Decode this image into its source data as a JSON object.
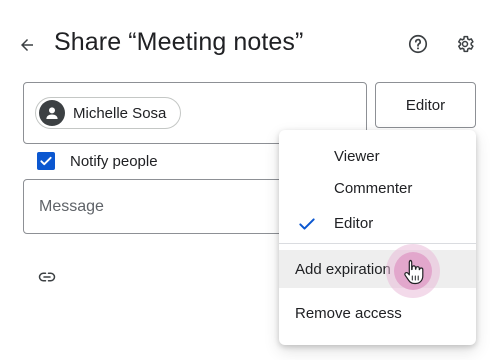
{
  "header": {
    "title": "Share “Meeting notes”",
    "back_icon": "arrow-back-icon",
    "help_icon": "help-icon",
    "settings_icon": "gear-icon"
  },
  "recipient": {
    "name": "Michelle Sosa",
    "avatar_icon": "person-icon"
  },
  "role_button": {
    "label": "Editor"
  },
  "notify": {
    "label": "Notify people",
    "checked": true
  },
  "message": {
    "placeholder": "Message"
  },
  "link": {
    "icon": "link-icon"
  },
  "role_menu": {
    "items": [
      {
        "label": "Viewer",
        "selected": false
      },
      {
        "label": "Commenter",
        "selected": false
      },
      {
        "label": "Editor",
        "selected": true
      }
    ],
    "actions": [
      {
        "label": "Add expiration",
        "hovered": true
      },
      {
        "label": "Remove access",
        "hovered": false
      }
    ]
  },
  "colors": {
    "accent": "#0b57d0",
    "text": "#202124",
    "border": "#8d9095",
    "hover_bg": "#eeeeee",
    "ripple": "#e2a7cc"
  }
}
